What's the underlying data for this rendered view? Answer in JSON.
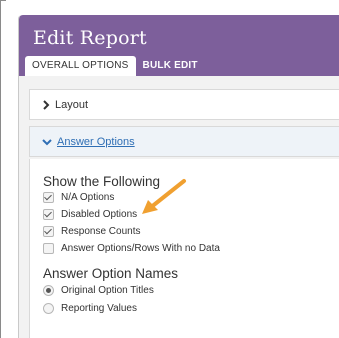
{
  "panel": {
    "title": "Edit Report",
    "tabs": [
      {
        "label": "OVERALL OPTIONS",
        "active": true
      },
      {
        "label": "BULK EDIT",
        "active": false
      }
    ],
    "header_color": "#7d5f9b"
  },
  "sections": {
    "layout": {
      "label": "Layout",
      "expanded": false,
      "icon": "chevron-right-icon"
    },
    "answer_options": {
      "label": "Answer Options",
      "expanded": true,
      "icon": "chevron-down-icon"
    }
  },
  "show_following": {
    "title": "Show the Following",
    "options": [
      {
        "label": "N/A Options",
        "checked": true
      },
      {
        "label": "Disabled Options",
        "checked": true
      },
      {
        "label": "Response Counts",
        "checked": true
      },
      {
        "label": "Answer Options/Rows With no Data",
        "checked": false
      }
    ]
  },
  "answer_option_names": {
    "title": "Answer Option Names",
    "options": [
      {
        "label": "Original Option Titles",
        "selected": true
      },
      {
        "label": "Reporting Values",
        "selected": false
      }
    ]
  },
  "annotation": {
    "icon": "arrow-pointer-icon",
    "color": "#f0a030"
  },
  "link_color": "#2f6fb5"
}
